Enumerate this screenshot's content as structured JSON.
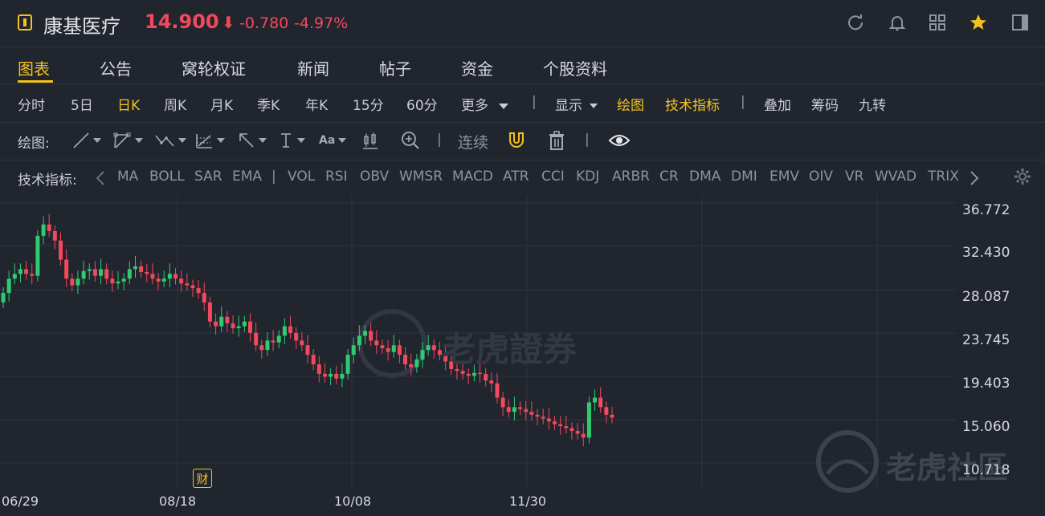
{
  "header": {
    "stock_name": "康基医疗",
    "price": "14.900",
    "price_arrow": "⬇",
    "change": "-0.780",
    "change_pct": "-4.97%"
  },
  "tabs": [
    {
      "label": "图表"
    },
    {
      "label": "公告"
    },
    {
      "label": "窝轮权证"
    },
    {
      "label": "新闻"
    },
    {
      "label": "帖子"
    },
    {
      "label": "资金"
    },
    {
      "label": "个股资料"
    }
  ],
  "periods": {
    "items": [
      "分时",
      "5日",
      "日K",
      "周K",
      "月K",
      "季K",
      "年K",
      "15分",
      "60分"
    ],
    "active": "日K",
    "more": "更多",
    "sep": "|",
    "display": "显示",
    "draw": "绘图",
    "indicators": "技术指标",
    "overlay": "叠加",
    "chips": "筹码",
    "nine": "九转"
  },
  "drawing": {
    "label": "绘图:",
    "tools": [
      "line-tool-icon",
      "trend-tool-icon",
      "wave-tool-icon",
      "fib-tool-icon",
      "arrow-tool-icon",
      "text-height-tool-icon",
      "font-tool-icon",
      "candle-tool-icon",
      "zoom-tool-icon"
    ],
    "font_tool": "Aa",
    "continuous": "连续"
  },
  "indicators": {
    "label": "技术指标:",
    "items": [
      "MA",
      "BOLL",
      "SAR",
      "EMA",
      "|",
      "VOL",
      "RSI",
      "OBV",
      "WMSR",
      "MACD",
      "ATR",
      "CCI",
      "KDJ",
      "ARBR",
      "CR",
      "DMA",
      "DMI",
      "EMV",
      "OIV",
      "VR",
      "WVAD",
      "TRIX"
    ]
  },
  "colors": {
    "up": "#f2495c",
    "down": "#2ecc71",
    "accent": "#f4c21b",
    "bg": "#21252e"
  },
  "chart_data": {
    "type": "candlestick",
    "y_ticks": [
      "36.772",
      "32.430",
      "28.087",
      "23.745",
      "19.403",
      "15.060",
      "10.718"
    ],
    "ylim": [
      10.718,
      36.772
    ],
    "x_ticks": [
      "06/29",
      "08/18",
      "10/08",
      "11/30"
    ],
    "financial_badge": "财",
    "closes": [
      28.0,
      29.5,
      30.0,
      30.5,
      30.0,
      29.8,
      34.0,
      35.2,
      34.5,
      33.5,
      31.5,
      29.5,
      28.8,
      29.5,
      30.3,
      30.5,
      29.8,
      30.5,
      29.5,
      29.0,
      29.2,
      29.5,
      30.5,
      30.8,
      30.2,
      30.0,
      29.5,
      29.2,
      29.5,
      30.0,
      29.5,
      29.0,
      28.8,
      28.5,
      28.0,
      27.0,
      25.0,
      24.5,
      25.5,
      24.8,
      24.3,
      24.5,
      25.0,
      23.8,
      22.5,
      22.0,
      23.0,
      22.8,
      23.5,
      24.5,
      23.8,
      23.0,
      22.5,
      21.5,
      20.5,
      19.5,
      19.2,
      19.5,
      19.0,
      19.5,
      21.5,
      22.5,
      23.5,
      24.0,
      23.0,
      22.5,
      22.2,
      21.8,
      22.5,
      21.5,
      20.5,
      20.2,
      21.0,
      22.0,
      22.5,
      22.0,
      21.5,
      20.8,
      20.0,
      19.8,
      19.5,
      19.3,
      19.6,
      19.5,
      18.8,
      18.5,
      17.0,
      16.0,
      15.5,
      16.0,
      15.8,
      15.5,
      15.2,
      15.0,
      14.8,
      14.5,
      14.2,
      14.0,
      13.8,
      13.5,
      13.2,
      12.8,
      16.5,
      17.0,
      16.0,
      15.2,
      14.9
    ]
  }
}
